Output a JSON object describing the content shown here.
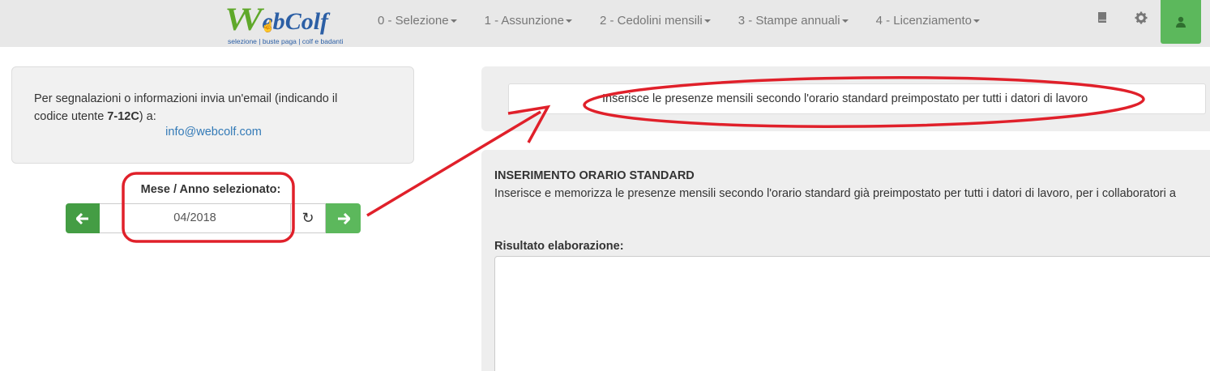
{
  "logo": {
    "ww": "VV",
    "eb": "eb",
    "colf": "Colf",
    "tagline": "selezione | buste paga | colf e badanti"
  },
  "nav": {
    "items": [
      {
        "label": "0 - Selezione"
      },
      {
        "label": "1 - Assunzione"
      },
      {
        "label": "2 - Cedolini mensili"
      },
      {
        "label": "3 - Stampe annuali"
      },
      {
        "label": "4 - Licenziamento"
      }
    ],
    "icons": [
      "book-icon",
      "gear-icon",
      "user-icon"
    ]
  },
  "info": {
    "text_before": "Per segnalazioni o informazioni invia un'email (indicando il codice utente ",
    "user_code": "7-12C",
    "text_after": ") a:",
    "email": "info@webcolf.com"
  },
  "month": {
    "label": "Mese / Anno selezionato:",
    "value": "04/2018"
  },
  "description": {
    "text": "Inserisce le presenze mensili secondo l'orario standard preimpostato per tutti i datori di lavoro"
  },
  "main": {
    "title": "INSERIMENTO ORARIO STANDARD",
    "desc": "Inserisce e memorizza le presenze mensili secondo l'orario standard già preimpostato per tutti i datori di lavoro, per i collaboratori a",
    "result_label": "Risultato elaborazione:",
    "result_value": ""
  },
  "colors": {
    "navbar_bg": "#e8e8e8",
    "success_green": "#5cb85c",
    "success_green_dark": "#449d44",
    "link_blue": "#337ab7",
    "annotation_red": "#e0202a"
  }
}
